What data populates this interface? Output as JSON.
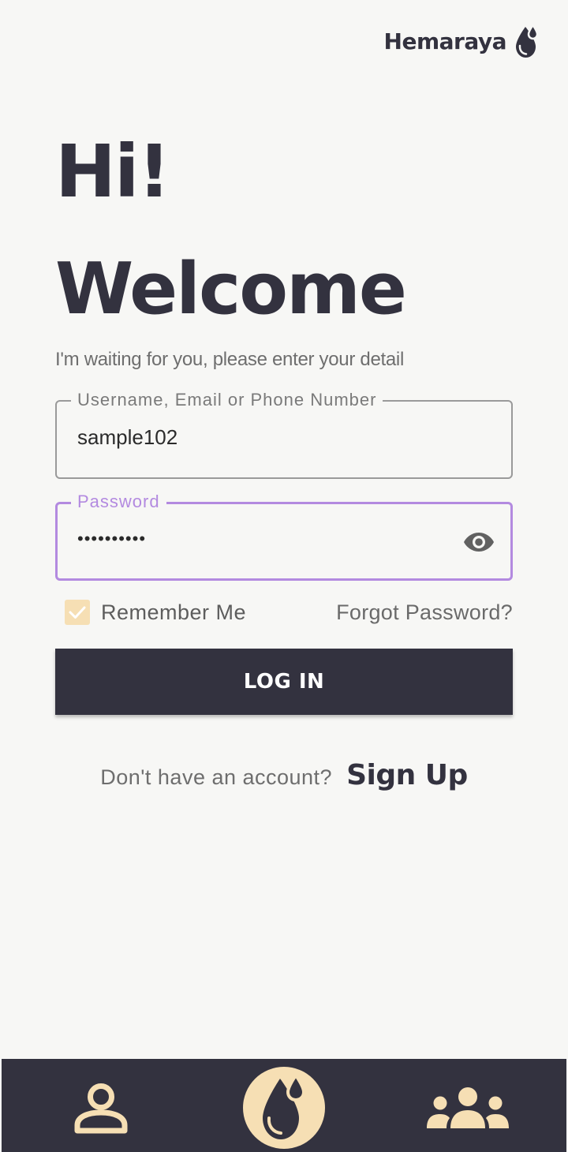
{
  "brand": {
    "name": "Hemaraya",
    "icon": "blood-drops-icon"
  },
  "header": {
    "greeting": "Hi!",
    "title": "Welcome",
    "subtitle": "I'm waiting for you, please enter your detail"
  },
  "form": {
    "username": {
      "label": "Username, Email or Phone Number",
      "value": "sample102"
    },
    "password": {
      "label": "Password",
      "value": "••••••••••",
      "toggle_icon": "eye-icon"
    },
    "remember_me": {
      "label": "Remember Me",
      "checked": true
    },
    "forgot_password": "Forgot Password?",
    "login_button": "LOG IN"
  },
  "signup": {
    "question": "Don't have an account?",
    "link": "Sign Up"
  },
  "bottom_nav": {
    "items": [
      "person-icon",
      "blood-drops-icon",
      "group-icon"
    ]
  },
  "colors": {
    "primary_dark": "#33323f",
    "accent_cream": "#f6dfb4",
    "focus_purple": "#b38ae0",
    "background": "#f7f7f5"
  }
}
